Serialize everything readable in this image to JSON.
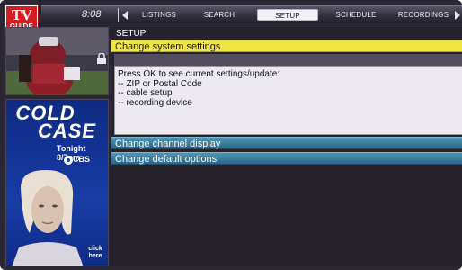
{
  "app": {
    "logo_top": "TV",
    "logo_bottom": "GUIDE",
    "clock": "8:08"
  },
  "nav": {
    "tabs": [
      {
        "label": "LISTINGS"
      },
      {
        "label": "SEARCH"
      },
      {
        "label": "SETUP",
        "active": true
      },
      {
        "label": "SCHEDULE"
      },
      {
        "label": "RECORDINGS"
      }
    ]
  },
  "ad": {
    "title_line1": "COLD",
    "title_line2": "CASE",
    "time": "Tonight 8/7pm",
    "network": "CBS",
    "cta_line1": "click",
    "cta_line2": "here"
  },
  "main": {
    "section_title": "SETUP",
    "options": [
      {
        "label": "Change system settings",
        "selected": true
      },
      {
        "label": "Change channel display",
        "selected": false
      },
      {
        "label": "Change default options",
        "selected": false
      }
    ],
    "info_lines": [
      "Press OK to see current settings/update:",
      "-- ZIP or Postal Code",
      "-- cable setup",
      "-- recording device"
    ]
  },
  "colors": {
    "selected_bar": "#f2e542",
    "option_bar": "#3a7d9d",
    "logo_red": "#d21d23",
    "background": "#26232d"
  },
  "icons": [
    "lock-icon",
    "arrow-left-icon",
    "arrow-right-icon",
    "cbs-eye-icon"
  ]
}
